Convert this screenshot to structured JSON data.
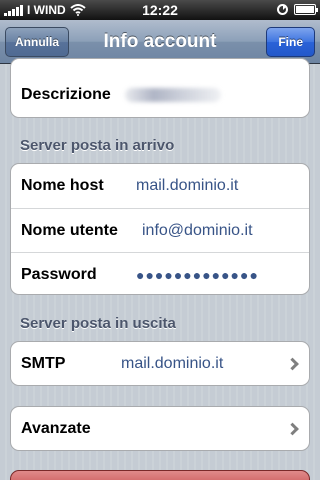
{
  "status_bar": {
    "carrier": "I WIND",
    "time": "12:22"
  },
  "nav": {
    "title": "Info account",
    "cancel_label": "Annulla",
    "done_label": "Fine"
  },
  "account": {
    "description_label": "Descrizione"
  },
  "incoming": {
    "header": "Server posta in arrivo",
    "host_label": "Nome host",
    "host_value": "mail.dominio.it",
    "user_label": "Nome utente",
    "user_value": "info@dominio.it",
    "password_label": "Password",
    "password_value": "●●●●●●●●●●●●●"
  },
  "outgoing": {
    "header": "Server posta in uscita",
    "smtp_label": "SMTP",
    "smtp_value": "mail.dominio.it"
  },
  "advanced": {
    "label": "Avanzate"
  },
  "colors": {
    "value_text": "#385487",
    "section_header": "#4c566c",
    "done_button": "#2a62d8",
    "nav_bar": "#7b90ab"
  },
  "icons": [
    "wifi-icon",
    "signal-bars-icon",
    "rotation-lock-icon",
    "battery-icon",
    "chevron-right-icon"
  ]
}
